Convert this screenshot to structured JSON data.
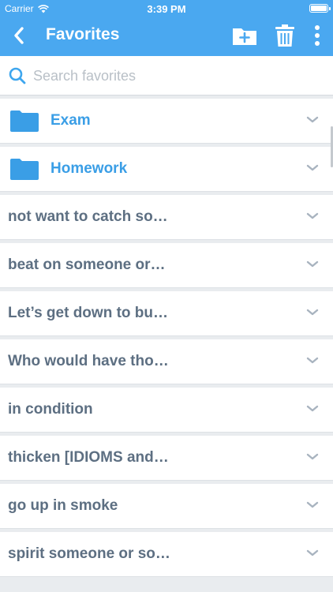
{
  "status_bar": {
    "carrier": "Carrier",
    "time": "3:39 PM"
  },
  "nav": {
    "title": "Favorites",
    "icons": {
      "back": "chevron-left-icon",
      "new_folder": "folder-plus-icon",
      "delete": "trash-icon",
      "more": "more-vertical-icon"
    }
  },
  "search": {
    "placeholder": "Search favorites",
    "value": ""
  },
  "colors": {
    "accent": "#4aa8f0",
    "folder": "#3a9ee6",
    "entry_text": "#5d6f82",
    "background": "#e9ecef"
  },
  "folders": [
    {
      "label": "Exam"
    },
    {
      "label": "Homework"
    }
  ],
  "entries": [
    {
      "label": "not want to catch so…"
    },
    {
      "label": "beat on someone or…"
    },
    {
      "label": "Let’s get down to bu…"
    },
    {
      "label": "Who would have tho…"
    },
    {
      "label": "in condition"
    },
    {
      "label": "thicken [IDIOMS and…"
    },
    {
      "label": "go up in smoke"
    },
    {
      "label": "spirit someone or so…"
    }
  ]
}
